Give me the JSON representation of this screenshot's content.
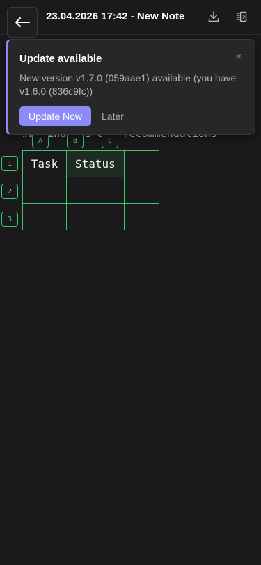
{
  "header": {
    "title": "23.04.2026 17:42 - New Note",
    "back_icon": "arrow-left-icon",
    "download_icon": "download-icon",
    "panel_icon": "sidebar-panel-icon"
  },
  "editor": {
    "hidden_heading": "## Findings and recommendations",
    "column_tags": [
      "A",
      "B",
      "C"
    ],
    "row_tags": [
      "1",
      "2",
      "3"
    ],
    "table": {
      "rows": [
        [
          "Task",
          "Status",
          ""
        ],
        [
          "",
          "",
          ""
        ],
        [
          "",
          "",
          ""
        ]
      ]
    },
    "accent_color": "#3cc569"
  },
  "toast": {
    "title": "Update available",
    "message": "New version v1.7.0 (059aae1) available (you have v1.6.0 (836c9fc))",
    "primary_label": "Update Now",
    "secondary_label": "Later",
    "close_label": "×",
    "accent_color": "#8b8cf7"
  }
}
